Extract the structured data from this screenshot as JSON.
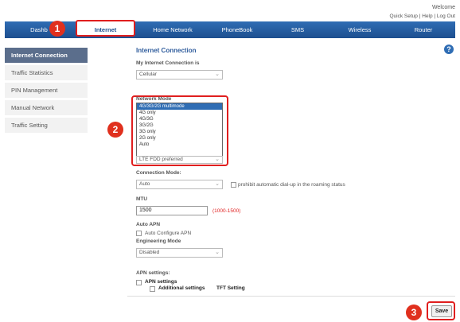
{
  "header": {
    "welcome": "Welcome",
    "links": "Quick Setup | Help | Log Out"
  },
  "nav": [
    "Dashb",
    "Internet",
    "Home Network",
    "PhoneBook",
    "SMS",
    "Wireless",
    "Router"
  ],
  "sidebar": [
    "Internet Connection",
    "Traffic Statistics",
    "PIN Management",
    "Manual Network",
    "Traffic Setting"
  ],
  "main": {
    "title": "Internet Connection",
    "my_connection_label": "My Internet Connection is",
    "my_connection_value": "Cellular",
    "network_mode_label": "Network Mode",
    "network_mode_options": [
      "4G/3G/2G multimode",
      "4G only",
      "4G/3G",
      "3G/2G",
      "3G only",
      "2G only",
      "Auto"
    ],
    "network_mode_selected_index": 0,
    "lte_value": "LTE FDD preferred",
    "connection_mode_label": "Connection Mode:",
    "connection_mode_value": "Auto",
    "prohibit_label": "prohibit automatic dial-up in the roaming status",
    "mtu_label": "MTU",
    "mtu_value": "1500",
    "mtu_range": "(1000-1500)",
    "auto_apn_label": "Auto APN",
    "auto_configure_label": "Auto Configure APN",
    "engineering_mode_label": "Engineering Mode",
    "engineering_mode_value": "Disabled",
    "apn_settings_label": "APN settings:",
    "apn_settings_sub": "APN settings",
    "additional_settings": "Additional settings",
    "tft_setting": "TFT Setting",
    "save_label": "Save"
  },
  "callouts": [
    "1",
    "2",
    "3"
  ],
  "colors": {
    "nav": "#1d4f8f",
    "highlight": "#e01e1e",
    "badge": "#e0301e",
    "sidebar_active": "#5b6e8c"
  }
}
